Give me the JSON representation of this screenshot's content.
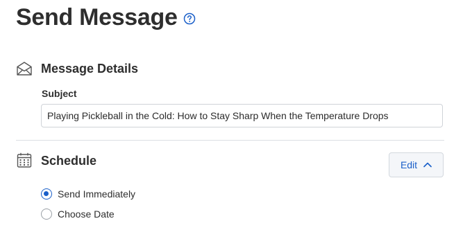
{
  "page": {
    "title": "Send Message",
    "help_icon": "question-circle-icon"
  },
  "message_details": {
    "icon": "open-envelope-icon",
    "title": "Message Details",
    "subject_label": "Subject",
    "subject_value": "Playing Pickleball in the Cold: How to Stay Sharp When the Temperature Drops"
  },
  "schedule": {
    "icon": "calendar-icon",
    "title": "Schedule",
    "edit_label": "Edit",
    "edit_icon": "chevron-up-icon",
    "options": [
      {
        "label": "Send Immediately",
        "selected": true
      },
      {
        "label": "Choose Date",
        "selected": false
      }
    ]
  },
  "colors": {
    "accent": "#1a5fc9",
    "text": "#2e2e2e",
    "border": "#cfd3d8"
  }
}
